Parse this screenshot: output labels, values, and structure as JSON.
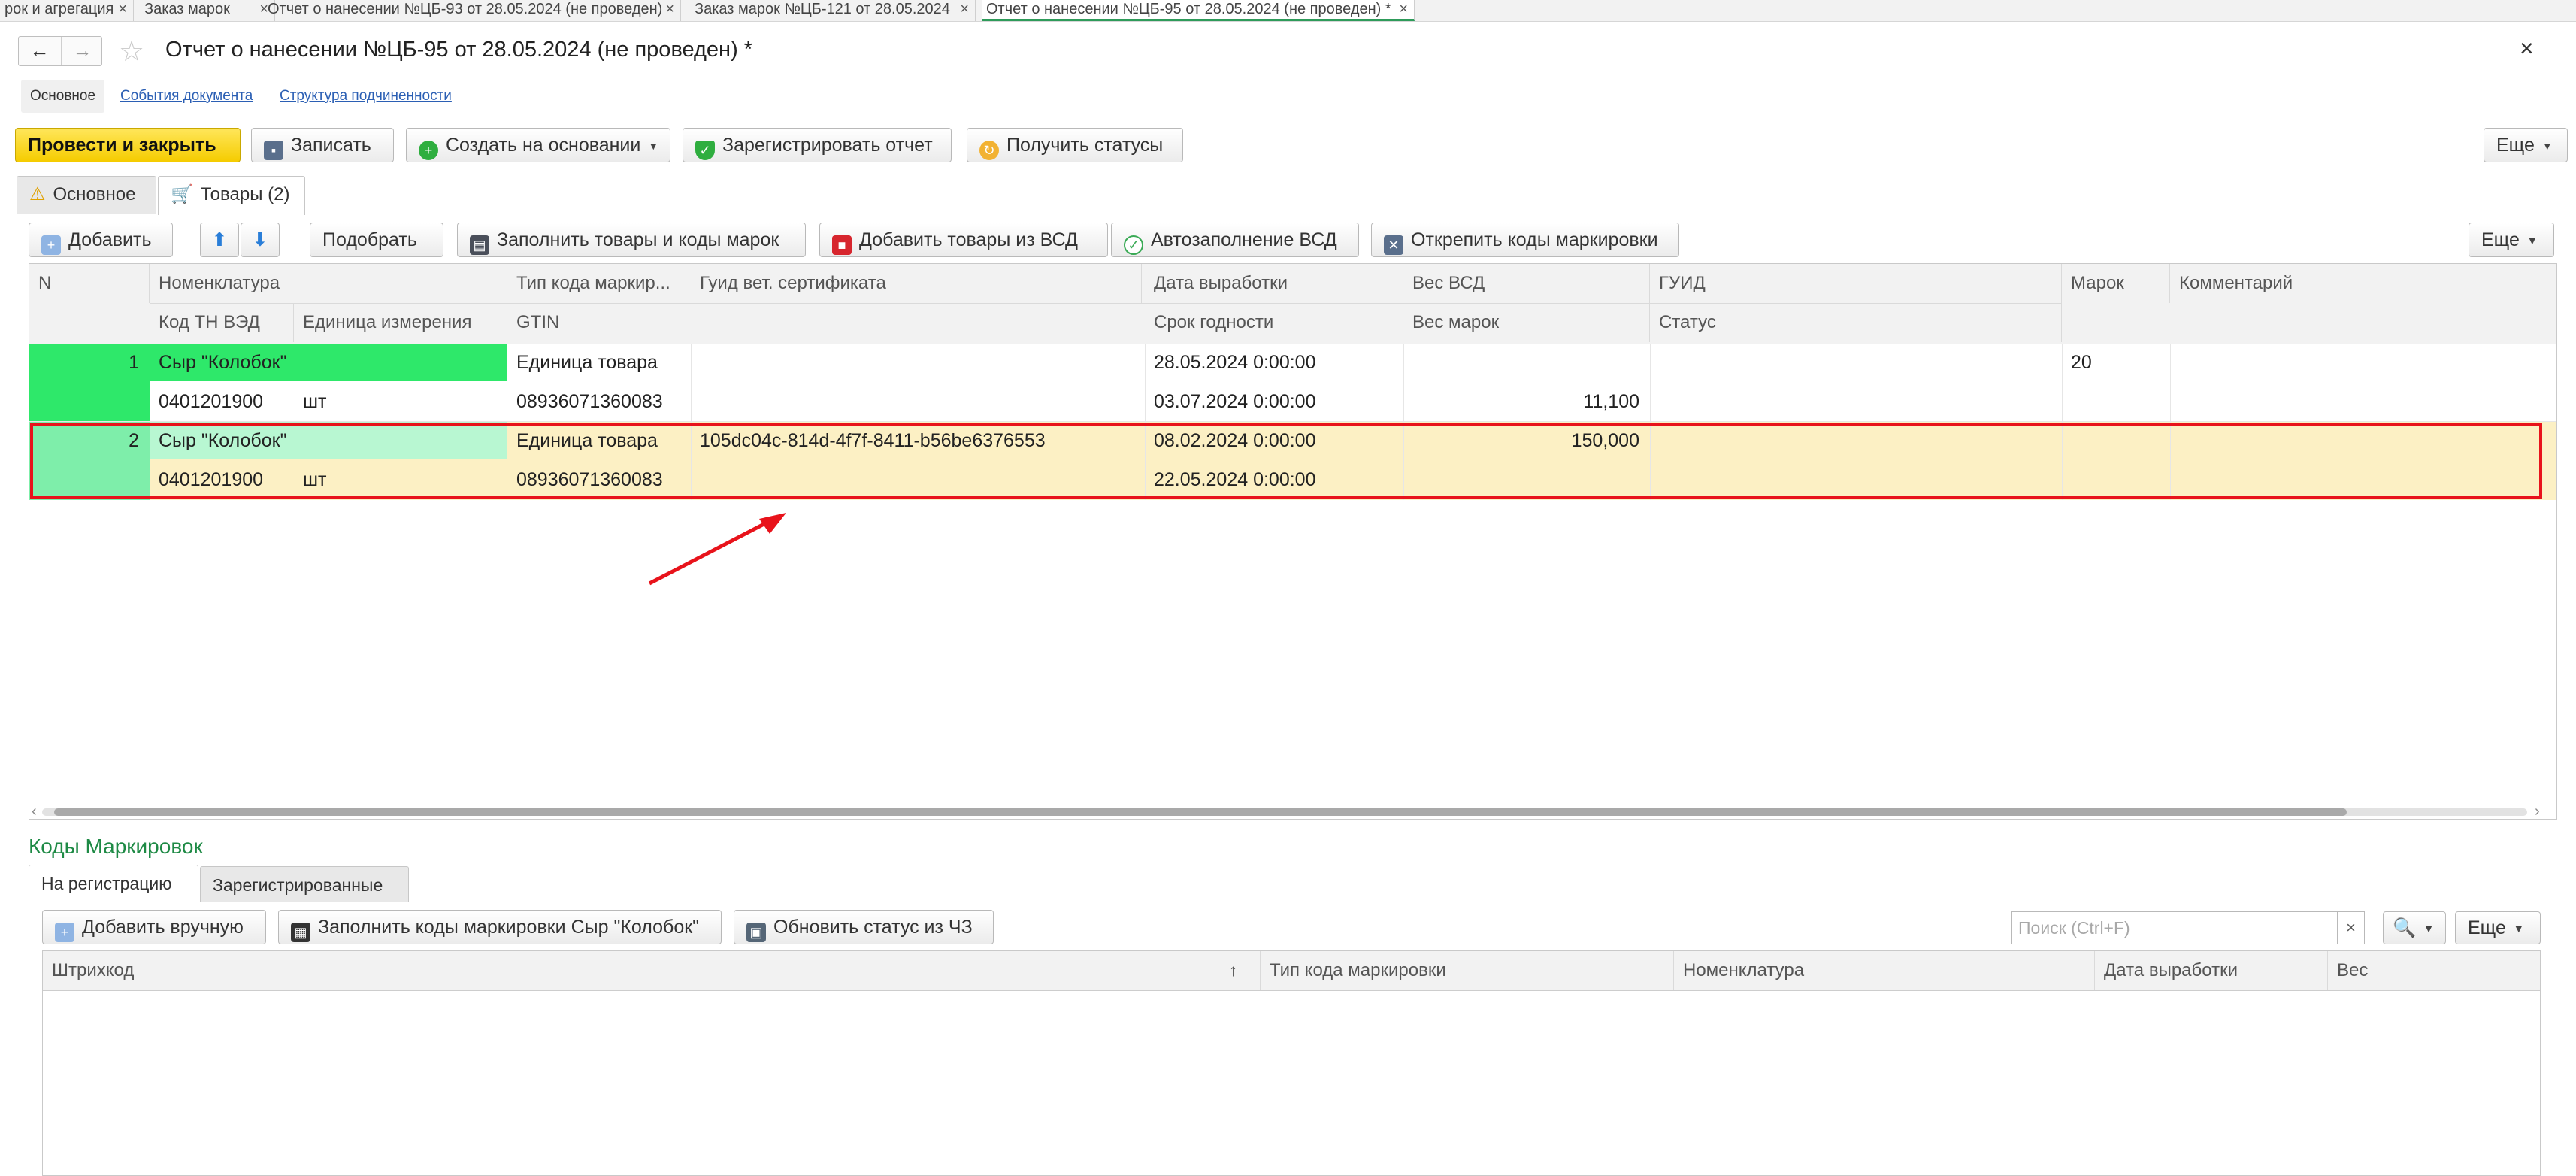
{
  "window_tabs": [
    {
      "label": "рок и агрегация"
    },
    {
      "label": "Заказ марок"
    },
    {
      "label": "Отчет о нанесении №ЦБ-93 от 28.05.2024 (не проведен)"
    },
    {
      "label": "Заказ марок №ЦБ-121 от 28.05.2024"
    },
    {
      "label": "Отчет о нанесении №ЦБ-95 от 28.05.2024 (не проведен) *"
    }
  ],
  "tab_close_glyph": "×",
  "nav": {
    "back": "←",
    "forward": "→",
    "star": "☆",
    "close": "×"
  },
  "title": "Отчет о нанесении №ЦБ-95 от 28.05.2024 (не проведен) *",
  "sublinks": {
    "main": "Основное",
    "events": "События документа",
    "structure": "Структура подчиненности"
  },
  "toolbar": {
    "post_close": "Провести и закрыть",
    "save": "Записать",
    "create_basis": "Создать на основании",
    "register_report": "Зарегистрировать отчет",
    "get_statuses": "Получить статусы",
    "more": "Еще"
  },
  "form_tabs": {
    "main": "Основное",
    "goods": "Товары (2)"
  },
  "goods_toolbar": {
    "add": "Добавить",
    "pick": "Подобрать",
    "fill_goods_codes": "Заполнить товары и коды марок",
    "add_from_vsd": "Добавить товары из ВСД",
    "autofill_vsd": "Автозаполнение ВСД",
    "detach_codes": "Открепить коды маркировки",
    "more": "Еще"
  },
  "goods_columns": {
    "n": "N",
    "nomenclature": "Номенклатура",
    "mark_type": "Тип кода маркир...",
    "vet_guid": "Гуид вет. сертификата",
    "production_date": "Дата выработки",
    "vsd_weight": "Вес ВСД",
    "guid": "ГУИД",
    "marks": "Марок",
    "comment": "Комментарий",
    "tn_ved": "Код ТН ВЭД",
    "unit": "Единица измерения",
    "gtin": "GTIN",
    "expiry": "Срок годности",
    "marks_weight": "Вес марок",
    "status": "Статус"
  },
  "goods_rows": [
    {
      "n": "1",
      "nomenclature": "Сыр \"Колобок\"",
      "mark_type": "Единица товара",
      "vet_guid": "",
      "production_date": "28.05.2024 0:00:00",
      "vsd_weight": "",
      "guid": "",
      "marks": "20",
      "comment": "",
      "tn_ved": "0401201900",
      "unit": "шт",
      "gtin": "08936071360083",
      "expiry": "03.07.2024 0:00:00",
      "marks_weight": "11,100",
      "status": ""
    },
    {
      "n": "2",
      "nomenclature": "Сыр \"Колобок\"",
      "mark_type": "Единица товара",
      "vet_guid": "105dc04c-814d-4f7f-8411-b56be6376553",
      "production_date": "08.02.2024 0:00:00",
      "vsd_weight": "150,000",
      "guid": "",
      "marks": "",
      "comment": "",
      "tn_ved": "0401201900",
      "unit": "шт",
      "gtin": "08936071360083",
      "expiry": "22.05.2024 0:00:00",
      "marks_weight": "",
      "status": ""
    }
  ],
  "scroll_arrows": {
    "left": "‹",
    "right": "›"
  },
  "codes": {
    "title": "Коды Маркировок",
    "tabs": {
      "registration": "На регистрацию",
      "registered": "Зарегистрированные"
    },
    "toolbar": {
      "add_manual": "Добавить вручную",
      "fill_codes": "Заполнить коды маркировки Сыр \"Колобок\"",
      "update_status": "Обновить статус из ЧЗ",
      "more": "Еще"
    },
    "search_placeholder": "Поиск (Ctrl+F)",
    "search_clear": "×",
    "columns": {
      "barcode": "Штрихкод",
      "sort_arrow": "↑",
      "mark_type": "Тип кода маркировки",
      "nomenclature": "Номенклатура",
      "production_date": "Дата выработки",
      "weight": "Вес"
    }
  },
  "colors": {
    "accent_green": "#1e8a45",
    "primary_button": "#f5cc00",
    "highlight_border": "#e8131b",
    "row_selected_bg": "#fcf0c4",
    "cell_green": "#2ee86a"
  }
}
